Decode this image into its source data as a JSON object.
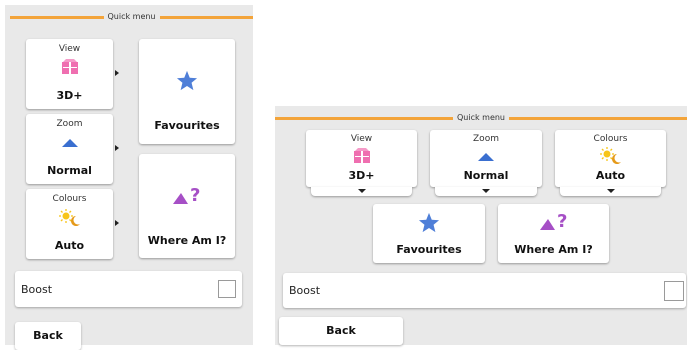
{
  "left_screen": {
    "header": "Quick menu",
    "tiles": [
      {
        "title": "View",
        "value": "3D+"
      },
      {
        "title": "Zoom",
        "value": "Normal"
      },
      {
        "title": "Colours",
        "value": "Auto"
      }
    ],
    "favourites_label": "Favourites",
    "where_am_i_label": "Where Am I?",
    "boost_label": "Boost",
    "back_label": "Back"
  },
  "right_screen": {
    "header": "Quick menu",
    "tiles": [
      {
        "title": "View",
        "value": "3D+"
      },
      {
        "title": "Zoom",
        "value": "Normal"
      },
      {
        "title": "Colours",
        "value": "Auto"
      }
    ],
    "favourites_label": "Favourites",
    "where_am_i_label": "Where Am I?",
    "boost_label": "Boost",
    "back_label": "Back"
  },
  "icons": {
    "view": "3d-buildings-icon",
    "zoom": "zoom-chevron-icon",
    "colours": "day-night-icon",
    "favourites": "star-icon",
    "where_am_i": "location-question-icon"
  },
  "colors": {
    "accent_line": "#f3a43a",
    "view_icon": "#ef6fb0",
    "zoom_icon": "#3a6fd0",
    "star_icon": "#4f7fd8",
    "where_icon": "#a64fc6",
    "sun_icon": "#f7c51a",
    "moon_icon": "#e59a1a"
  }
}
